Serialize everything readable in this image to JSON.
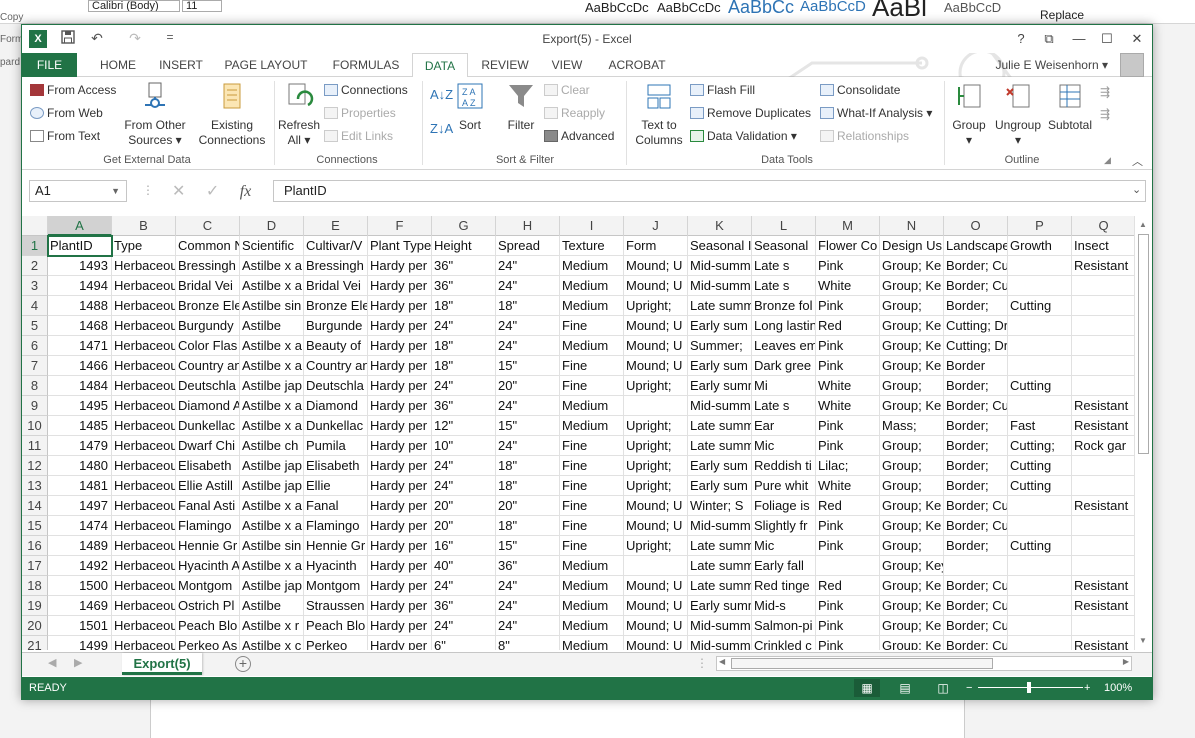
{
  "background": {
    "font_name": "Calibri (Body)",
    "font_size": "11",
    "styles": [
      "AaBbCcDc",
      "AaBbCcDc",
      "AaBbCc",
      "AaBbCcD",
      "AaBl",
      "AaBbCcD"
    ],
    "left_items": [
      "Copy",
      "Form",
      "pard"
    ],
    "replace_label": "Replace"
  },
  "window": {
    "title": "Export(5) - Excel",
    "help": "?",
    "restore_ribbon": "⧉",
    "minimize": "—",
    "maximize": "☐",
    "close": "✕"
  },
  "qat": {
    "save": "💾",
    "undo": "↶",
    "redo": "↷",
    "customize": "="
  },
  "tabs": [
    "FILE",
    "HOME",
    "INSERT",
    "PAGE LAYOUT",
    "FORMULAS",
    "DATA",
    "REVIEW",
    "VIEW",
    "ACROBAT"
  ],
  "user_name": "Julie E Weisenhorn",
  "ribbon": {
    "get_external": {
      "label": "Get External Data",
      "from_access": "From Access",
      "from_web": "From Web",
      "from_text": "From Text",
      "from_other_1": "From Other",
      "from_other_2": "Sources",
      "existing_1": "Existing",
      "existing_2": "Connections"
    },
    "connections": {
      "label": "Connections",
      "refresh_1": "Refresh",
      "refresh_2": "All",
      "connections": "Connections",
      "properties": "Properties",
      "edit_links": "Edit Links"
    },
    "sort_filter": {
      "label": "Sort & Filter",
      "sort": "Sort",
      "filter": "Filter",
      "clear": "Clear",
      "reapply": "Reapply",
      "advanced": "Advanced"
    },
    "data_tools": {
      "label": "Data Tools",
      "text_to_1": "Text to",
      "text_to_2": "Columns",
      "flash_fill": "Flash Fill",
      "remove_duplicates": "Remove Duplicates",
      "data_validation": "Data Validation",
      "consolidate": "Consolidate",
      "what_if": "What-If Analysis",
      "relationships": "Relationships"
    },
    "outline": {
      "label": "Outline",
      "group": "Group",
      "ungroup": "Ungroup",
      "subtotal": "Subtotal"
    }
  },
  "formula_bar": {
    "name_box": "A1",
    "fx": "fx",
    "content": "PlantID"
  },
  "columns": [
    "A",
    "B",
    "C",
    "D",
    "E",
    "F",
    "G",
    "H",
    "I",
    "J",
    "K",
    "L",
    "M",
    "N",
    "O",
    "P",
    "Q"
  ],
  "rows": [
    [
      "PlantID",
      "Type",
      "Common N",
      "Scientific",
      "Cultivar/V",
      "Plant Type",
      "Height",
      "Spread",
      "Texture",
      "Form",
      "Seasonal I",
      "Seasonal",
      "Flower Co",
      "Design Us",
      "Landscape",
      "Growth",
      "Insect"
    ],
    [
      "1493",
      "Herbaceous",
      "Bressingh",
      "Astilbe x a",
      "Bressingh",
      "Hardy per",
      "36\"",
      "24\"",
      "Medium",
      "Mound;  U",
      "Mid-summer;",
      "Late s",
      "Pink",
      "Group;  Ke",
      "Border;  Cutting",
      "",
      "Resistant"
    ],
    [
      "1494",
      "Herbaceous",
      "Bridal Vei",
      "Astilbe x a",
      "Bridal Vei",
      "Hardy per",
      "36\"",
      "24\"",
      "Medium",
      "Mound;  U",
      "Mid-summer;",
      "Late s",
      "White",
      "Group;  Ke",
      "Border;  Cutting",
      "",
      ""
    ],
    [
      "1488",
      "Herbaceous",
      "Bronze Ele",
      "Astilbe sin",
      "Bronze Ele",
      "Hardy per",
      "18\"",
      "18\"",
      "Medium",
      "Upright;",
      "Late summ",
      "Bronze fol",
      "Pink",
      "Group;",
      "Border;",
      "Cutting",
      ""
    ],
    [
      "1468",
      "Herbaceous",
      "Burgundy",
      "Astilbe",
      "Burgunde",
      "Hardy per",
      "24\"",
      "24\"",
      "Fine",
      "Mound;  U",
      "Early sum",
      "Long lastin",
      "Red",
      "Group;  Ke",
      "Cutting;  Drying",
      "",
      ""
    ],
    [
      "1471",
      "Herbaceous",
      "Color Flas",
      "Astilbe x a",
      "Beauty of",
      "Hardy per",
      "18\"",
      "24\"",
      "Medium",
      "Mound;  U",
      "Summer;",
      "Leaves em",
      "Pink",
      "Group;  Ke",
      "Cutting;  Drying",
      "",
      ""
    ],
    [
      "1466",
      "Herbaceous",
      "Country an",
      "Astilbe x a",
      "Country an",
      "Hardy per",
      "18\"",
      "15\"",
      "Fine",
      "Mound;  U",
      "Early sum",
      "Dark gree",
      "Pink",
      "Group;  Ke",
      "Border",
      "",
      ""
    ],
    [
      "1484",
      "Herbaceous",
      "Deutschla",
      "Astilbe jap",
      "Deutschla",
      "Hardy per",
      "24\"",
      "20\"",
      "Fine",
      "Upright;",
      "Early summer;",
      "Mi",
      "White",
      "Group;",
      "Border;",
      "Cutting",
      ""
    ],
    [
      "1495",
      "Herbaceous",
      "Diamond A",
      "Astilbe x a",
      "Diamond",
      "Hardy per",
      "36\"",
      "24\"",
      "Medium",
      "",
      "Mid-summer;",
      "Late s",
      "White",
      "Group;  Ke",
      "Border;  Cutting",
      "",
      "Resistant"
    ],
    [
      "1485",
      "Herbaceous",
      "Dunkellac",
      "Astilbe x a",
      "Dunkellac",
      "Hardy per",
      "12\"",
      "15\"",
      "Medium",
      "Upright;",
      "Late summer;",
      "Ear",
      "Pink",
      "Mass;",
      "Border;",
      "Fast",
      "Resistant"
    ],
    [
      "1479",
      "Herbaceous",
      "Dwarf Chi",
      "Astilbe ch",
      "Pumila",
      "Hardy per",
      "10\"",
      "24\"",
      "Fine",
      "Upright;",
      "Late summer;",
      "Mic",
      "Pink",
      "Group;",
      "Border;",
      "Cutting;",
      "Rock gar"
    ],
    [
      "1480",
      "Herbaceous",
      "Elisabeth",
      "Astilbe jap",
      "Elisabeth",
      "Hardy per",
      "24\"",
      "18\"",
      "Fine",
      "Upright;",
      "Early sum",
      "Reddish ti",
      "Lilac;",
      "Group;",
      "Border;",
      "Cutting",
      ""
    ],
    [
      "1481",
      "Herbaceous",
      "Ellie Astill",
      "Astilbe jap",
      "Ellie",
      "Hardy per",
      "24\"",
      "18\"",
      "Fine",
      "Upright;",
      "Early sum",
      "Pure whit",
      "White",
      "Group;",
      "Border;",
      "Cutting",
      ""
    ],
    [
      "1497",
      "Herbaceous",
      "Fanal Asti",
      "Astilbe x a",
      "Fanal",
      "Hardy per",
      "20\"",
      "20\"",
      "Fine",
      "Mound;  U",
      "Winter;  S",
      "Foliage is",
      "Red",
      "Group;  Ke",
      "Border;  Cutting",
      "",
      "Resistant"
    ],
    [
      "1474",
      "Herbaceous",
      "Flamingo",
      "Astilbe x a",
      "Flamingo",
      "Hardy per",
      "20\"",
      "18\"",
      "Fine",
      "Mound;  U",
      "Mid-summ",
      "Slightly fr",
      "Pink",
      "Group;  Ke",
      "Border;  Cutting",
      "",
      ""
    ],
    [
      "1489",
      "Herbaceous",
      "Hennie Gr",
      "Astilbe sin",
      "Hennie Gr",
      "Hardy per",
      "16\"",
      "15\"",
      "Fine",
      "Upright;",
      "Late summer;",
      "Mic",
      "Pink",
      "Group;",
      "Border;",
      "Cutting",
      ""
    ],
    [
      "1492",
      "Herbaceous",
      "Hyacinth A",
      "Astilbe x a",
      "Hyacinth",
      "Hardy per",
      "40\"",
      "36\"",
      "Medium",
      "",
      "Late summer;",
      "Early fall",
      "",
      "Group;  Key;  Mass;  Specimen",
      "",
      "",
      ""
    ],
    [
      "1500",
      "Herbaceous",
      "Montgom",
      "Astilbe jap",
      "Montgom",
      "Hardy per",
      "24\"",
      "24\"",
      "Medium",
      "Mound;  U",
      "Late summ",
      "Red tinge",
      "Red",
      "Group;  Ke",
      "Border;  Cutting",
      "",
      "Resistant"
    ],
    [
      "1469",
      "Herbaceous",
      "Ostrich Pl",
      "Astilbe",
      "Straussen",
      "Hardy per",
      "36\"",
      "24\"",
      "Medium",
      "Mound;  U",
      "Early summer;",
      "Mid-s",
      "Pink",
      "Group;  Ke",
      "Border;  Cutting",
      "",
      "Resistant"
    ],
    [
      "1501",
      "Herbaceous",
      "Peach Blo",
      "Astilbe x r",
      "Peach Blo",
      "Hardy per",
      "24\"",
      "24\"",
      "Medium",
      "Mound;  U",
      "Mid-summ",
      "Salmon-pi",
      "Pink",
      "Group;  Ke",
      "Border;  Cutting",
      "",
      ""
    ],
    [
      "1499",
      "Herbaceous",
      "Perkeo As",
      "Astilbe x c",
      "Perkeo",
      "Hardy per",
      "6\"",
      "8\"",
      "Medium",
      "Mound;  U",
      "Mid-summ",
      "Crinkled c",
      "Pink",
      "Group;  Ke",
      "Border;  Cutting",
      "",
      "Resistant"
    ]
  ],
  "row_numbers": [
    "1",
    "2",
    "3",
    "4",
    "5",
    "6",
    "7",
    "8",
    "9",
    "10",
    "11",
    "12",
    "13",
    "14",
    "15",
    "16",
    "17",
    "18",
    "19",
    "20",
    "21"
  ],
  "sheet_tab": "Export(5)",
  "add_sheet": "+",
  "status": {
    "ready": "READY",
    "zoom": "100%",
    "zoom_out": "−",
    "zoom_in": "+"
  },
  "colors": {
    "accent": "#217346"
  }
}
